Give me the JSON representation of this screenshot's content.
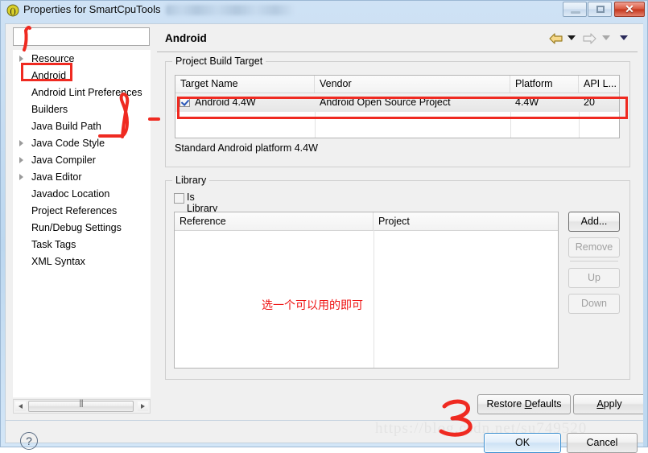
{
  "window": {
    "title": "Properties for SmartCpuTools",
    "icon": "eclipse-icon",
    "minimize_label": "",
    "maximize_label": "",
    "close_label": "✕"
  },
  "sidebar": {
    "filter_placeholder": "",
    "filter_value": "",
    "items": [
      {
        "label": "Resource",
        "expandable": true
      },
      {
        "label": "Android",
        "expandable": false,
        "selected": true
      },
      {
        "label": "Android Lint Preferences",
        "expandable": false
      },
      {
        "label": "Builders",
        "expandable": false
      },
      {
        "label": "Java Build Path",
        "expandable": false
      },
      {
        "label": "Java Code Style",
        "expandable": true
      },
      {
        "label": "Java Compiler",
        "expandable": true
      },
      {
        "label": "Java Editor",
        "expandable": true
      },
      {
        "label": "Javadoc Location",
        "expandable": false
      },
      {
        "label": "Project References",
        "expandable": false
      },
      {
        "label": "Run/Debug Settings",
        "expandable": false
      },
      {
        "label": "Task Tags",
        "expandable": false
      },
      {
        "label": "XML Syntax",
        "expandable": false
      }
    ]
  },
  "page": {
    "title": "Android",
    "nav": {
      "back_icon": "back-arrow-icon",
      "back_menu_icon": "chevron-down-icon",
      "forward_icon": "forward-arrow-icon",
      "forward_menu_icon": "chevron-down-icon",
      "view_menu_icon": "chevron-down-icon"
    }
  },
  "build_target": {
    "legend": "Project Build Target",
    "columns": [
      "Target Name",
      "Vendor",
      "Platform",
      "API L..."
    ],
    "rows": [
      {
        "checked": true,
        "target_name": "Android 4.4W",
        "vendor": "Android Open Source Project",
        "platform": "4.4W",
        "api_level": "20"
      }
    ],
    "description": "Standard Android platform 4.4W"
  },
  "library": {
    "legend": "Library",
    "is_library_label": "Is Library",
    "is_library_checked": false,
    "columns": [
      "Reference",
      "Project"
    ],
    "rows": [],
    "buttons": {
      "add": "Add...",
      "remove": "Remove",
      "up": "Up",
      "down": "Down"
    }
  },
  "footer": {
    "restore_defaults": "Restore Defaults",
    "restore_defaults_mnemonic": "D",
    "apply": "Apply",
    "apply_mnemonic": "A",
    "help_icon": "question-mark-icon",
    "ok": "OK",
    "cancel": "Cancel"
  },
  "annotations": {
    "note_cn": "选一个可以用的即可",
    "note_color": "#ee1111",
    "watermark": "https://blog.csdn.net/su749520"
  }
}
